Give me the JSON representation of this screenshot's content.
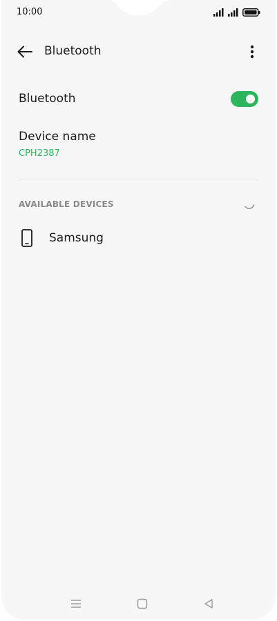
{
  "status_bar": {
    "time": "10:00",
    "icons": [
      "signal-icon",
      "signal-icon",
      "battery-icon"
    ]
  },
  "header": {
    "title": "Bluetooth",
    "back_icon": "arrow-left-icon",
    "menu_icon": "more-vertical-icon"
  },
  "bluetooth_setting": {
    "label": "Bluetooth",
    "enabled": true
  },
  "device_name": {
    "label": "Device name",
    "value": "CPH2387"
  },
  "available_devices": {
    "header": "AVAILABLE DEVICES",
    "scanning_icon": "spinner-icon",
    "devices": [
      {
        "label": "Samsung",
        "icon": "phone-icon"
      }
    ]
  },
  "nav_bar": {
    "buttons": [
      "menu-icon",
      "home-icon",
      "back-icon"
    ]
  },
  "colors": {
    "accent": "#2bb55c",
    "background": "#f7f7f7",
    "text": "#1b1b1b",
    "secondary_text": "#8a8a8a"
  }
}
